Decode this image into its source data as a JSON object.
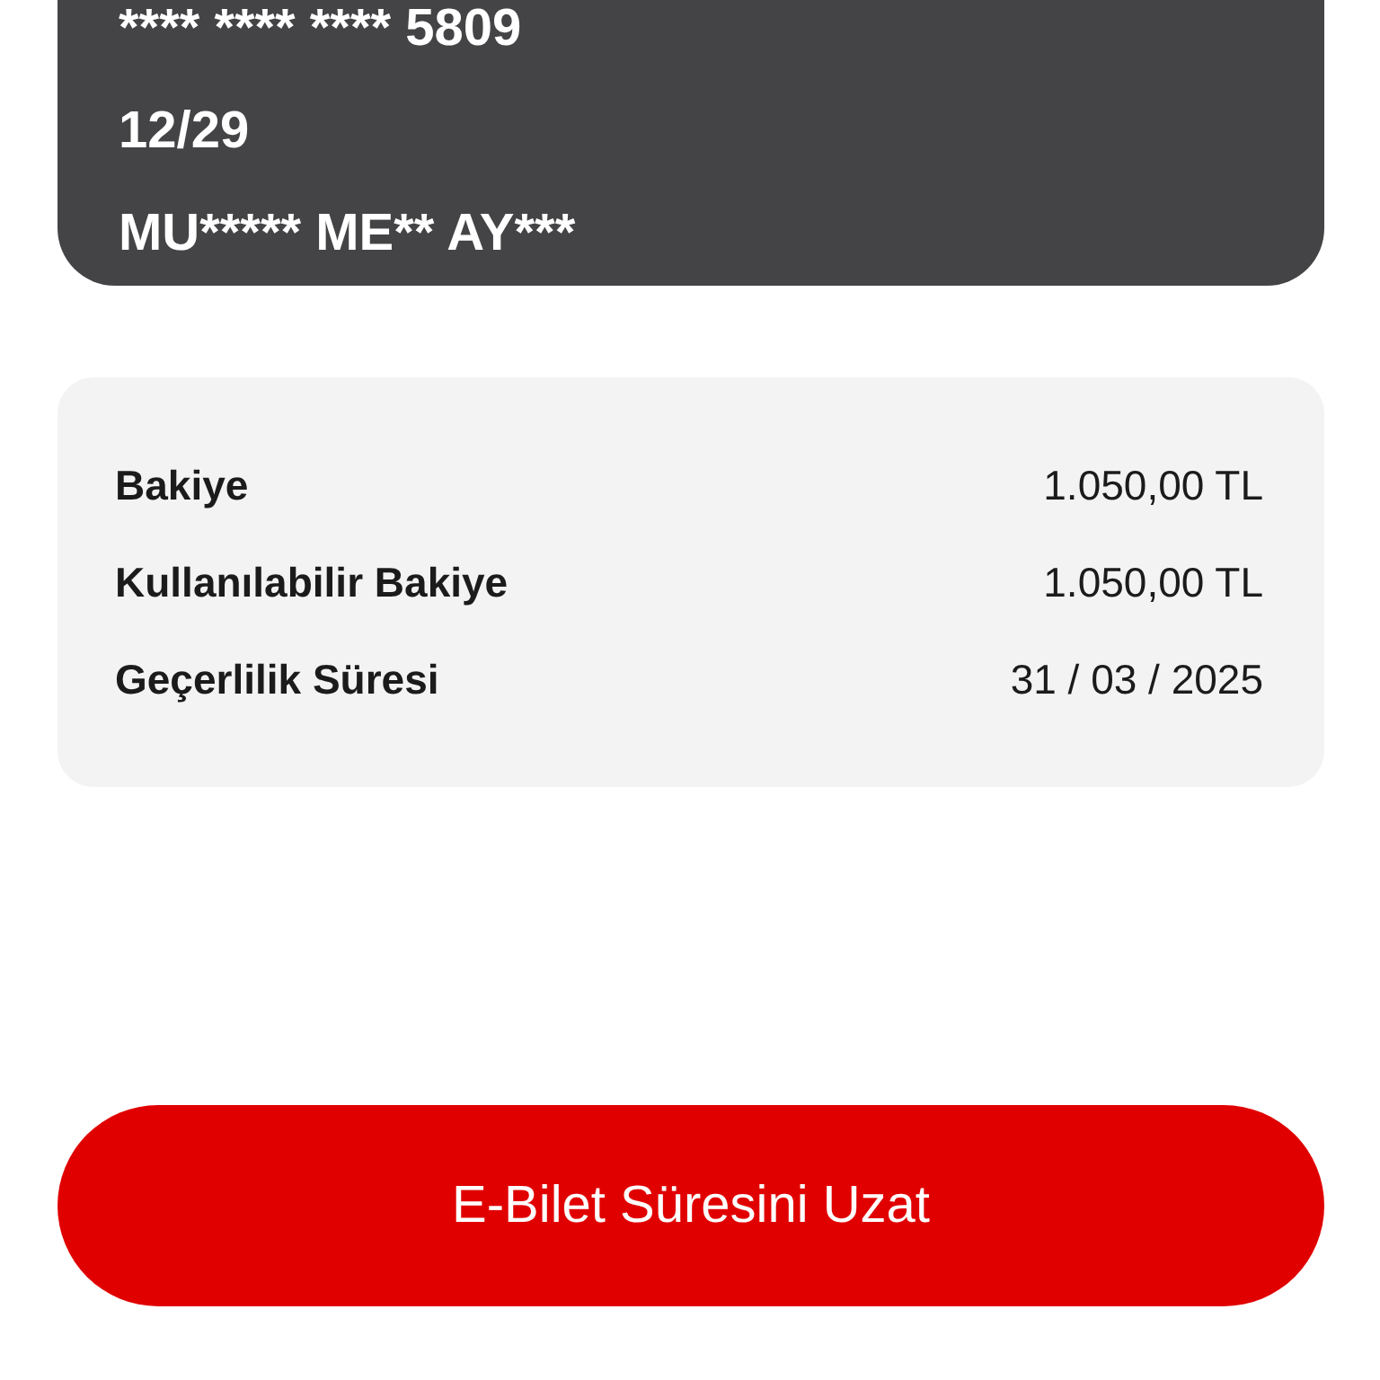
{
  "card": {
    "number": "**** **** **** 5809",
    "expiry": "12/29",
    "holder": "MU***** ME** AY***"
  },
  "balance": {
    "rows": [
      {
        "label": "Bakiye",
        "value": "1.050,00 TL"
      },
      {
        "label": "Kullanılabilir Bakiye",
        "value": "1.050,00 TL"
      },
      {
        "label": "Geçerlilik Süresi",
        "value": "31 / 03 / 2025"
      }
    ]
  },
  "button": {
    "label": "E-Bilet Süresini Uzat"
  }
}
